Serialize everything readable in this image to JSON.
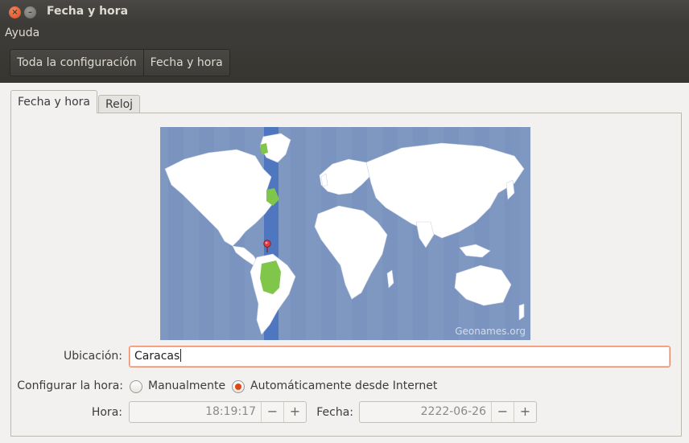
{
  "window": {
    "title": "Fecha y hora"
  },
  "menu": {
    "ayuda": "Ayuda"
  },
  "breadcrumbs": [
    "Toda la configuración",
    "Fecha y hora"
  ],
  "tabs": [
    {
      "label": "Fecha y hora",
      "active": true
    },
    {
      "label": "Reloj",
      "active": false
    }
  ],
  "map": {
    "attribution": "Geonames.org",
    "selected_city": "Caracas",
    "colors": {
      "ocean": "#7f98c2",
      "land": "#ffffff",
      "highlight_zone": "#4f77c0",
      "highlight_land": "#7fc64a",
      "pin": "#e0404a"
    }
  },
  "form": {
    "location_label": "Ubicación:",
    "location_value": "Caracas",
    "set_time_label": "Configurar la hora:",
    "manual_label": "Manualmente",
    "auto_label": "Automáticamente desde Internet",
    "selected_mode": "auto",
    "time_label": "Hora:",
    "time_value": "18:19:17",
    "date_label": "Fecha:",
    "date_value": "2222-06-26",
    "minus": "−",
    "plus": "+"
  }
}
